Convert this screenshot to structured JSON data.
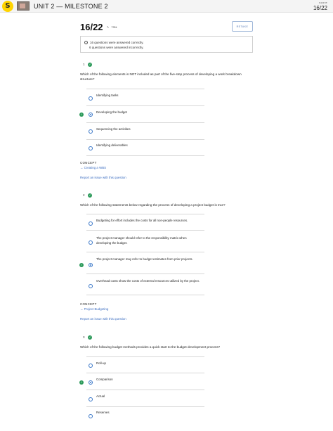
{
  "header": {
    "logo_letter": "S",
    "course_title": "UNIT 2 — MILESTONE 2",
    "score_label": "score",
    "score_value": "16/22"
  },
  "summary": {
    "score": "16/22",
    "percent": "73%",
    "retake_label": "RETAKE",
    "correct_text": "16 questions were answered correctly.",
    "incorrect_text": "6 questions were answered incorrectly."
  },
  "questions": [
    {
      "number": "1",
      "prompt": "Which of the following elements is NOT included as part of the five-step process of developing a work breakdown structure?",
      "answers": [
        {
          "text": "Identifying tasks"
        },
        {
          "text": "Developing the budget"
        },
        {
          "text": "Sequencing the activities"
        },
        {
          "text": "Identifying deliverables"
        }
      ],
      "selected_index": 1,
      "concept_label": "CONCEPT",
      "concept_link": "→ Creating a WBS",
      "report_link": "Report an issue with this question"
    },
    {
      "number": "2",
      "prompt": "Which of the following statements below regarding the process of developing a project budget is true?",
      "answers": [
        {
          "text": "Budgeting for effort includes the costs for all non-people resources."
        },
        {
          "text": "The project manager should refer to the responsibility matrix when developing the budget."
        },
        {
          "text": "The project manager may refer to budget estimates from prior projects."
        },
        {
          "text": "Overhead costs show the costs of external resources utilized by the project."
        }
      ],
      "selected_index": 2,
      "concept_label": "CONCEPT",
      "concept_link": "→ Project Budgeting",
      "report_link": "Report an issue with this question"
    },
    {
      "number": "3",
      "prompt": "Which of the following budget methods provides a quick start to the budget development process?",
      "answers": [
        {
          "text": "Roll-up"
        },
        {
          "text": "Comparison"
        },
        {
          "text": "Actual"
        },
        {
          "text": "Reserves"
        }
      ],
      "selected_index": 1
    }
  ],
  "icons": {
    "check": "check-icon",
    "info": "info-icon",
    "radio": "radio-icon"
  },
  "colors": {
    "brand": "#ffd400",
    "correct": "#2c9a5a",
    "accent": "#3a77c8"
  }
}
